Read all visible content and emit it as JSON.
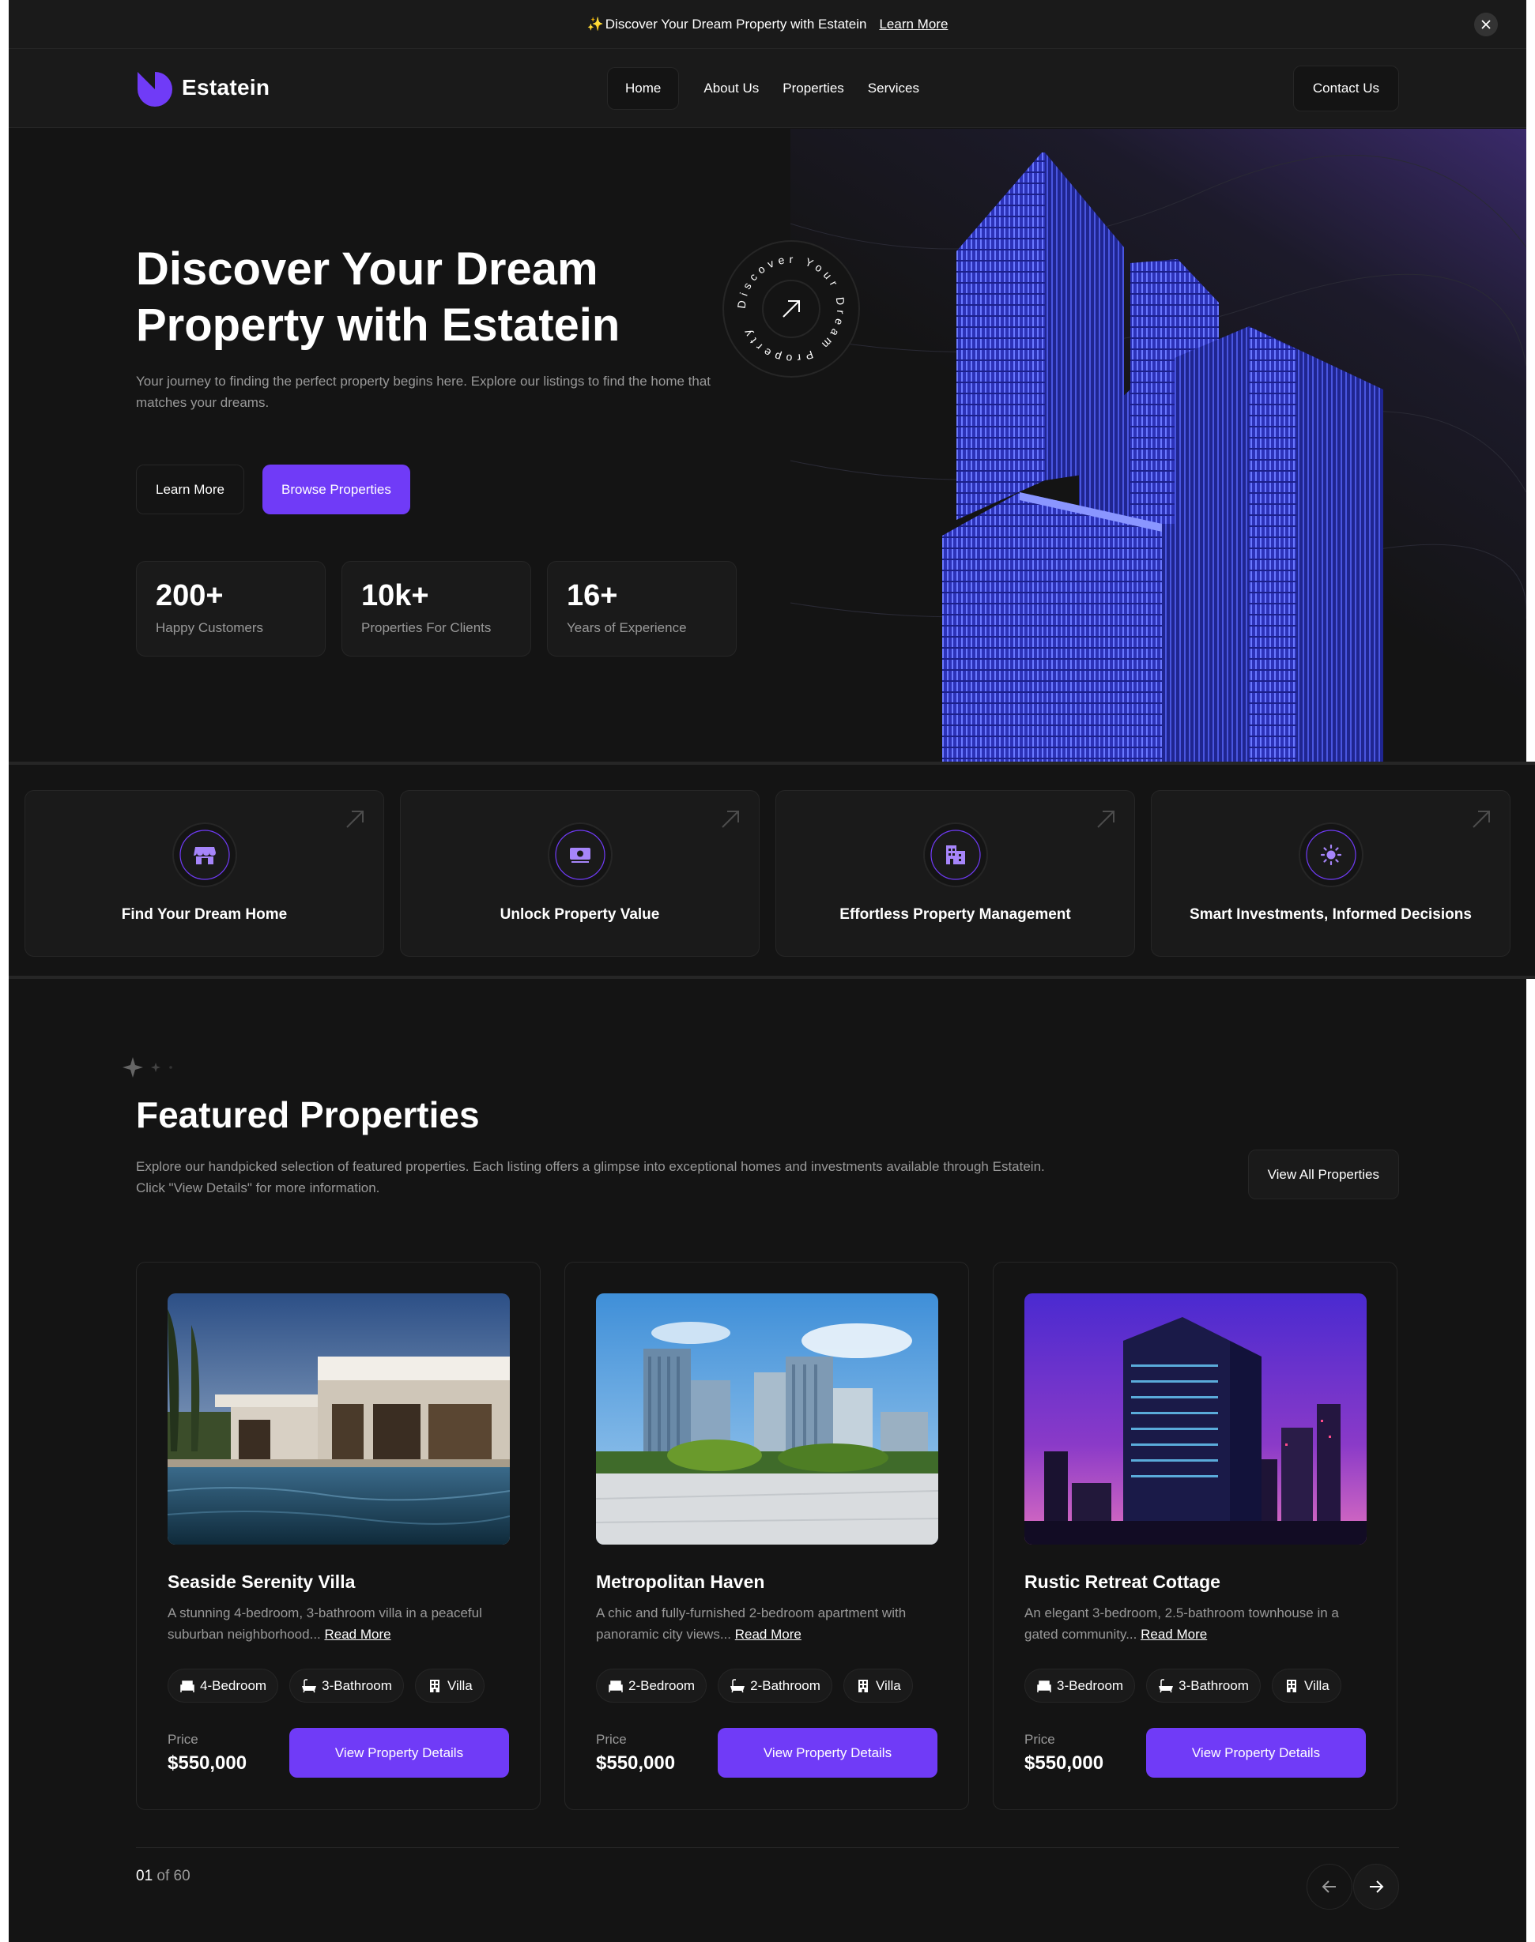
{
  "banner": {
    "text": "Discover Your Dream Property with Estatein",
    "link": "Learn More"
  },
  "nav": {
    "brand": "Estatein",
    "links": [
      "Home",
      "About Us",
      "Properties",
      "Services"
    ],
    "contact": "Contact Us"
  },
  "hero": {
    "title_line1": "Discover Your Dream",
    "title_line2": "Property with Estatein",
    "description": "Your journey to finding the perfect property begins here. Explore our listings to find the home that matches your dreams.",
    "learn_more": "Learn More",
    "browse": "Browse Properties",
    "badge_text": "Discover Your Dream Property ✨",
    "stats": [
      {
        "value": "200+",
        "label": "Happy Customers"
      },
      {
        "value": "10k+",
        "label": "Properties For Clients"
      },
      {
        "value": "16+",
        "label": "Years of Experience"
      }
    ]
  },
  "features": [
    {
      "label": "Find Your Dream Home",
      "icon": "storefront-icon"
    },
    {
      "label": "Unlock Property Value",
      "icon": "cash-icon"
    },
    {
      "label": "Effortless Property Management",
      "icon": "building-icon"
    },
    {
      "label": "Smart Investments, Informed Decisions",
      "icon": "sun-icon"
    }
  ],
  "featured": {
    "title": "Featured Properties",
    "description": "Explore our handpicked selection of featured properties. Each listing offers a glimpse into exceptional homes and investments available through Estatein. Click \"View Details\" for more information.",
    "view_all": "View All Properties",
    "cards": [
      {
        "title": "Seaside Serenity Villa",
        "desc": "A stunning 4-bedroom, 3-bathroom villa in a peaceful suburban neighborhood...",
        "read_more": "Read More",
        "tags": [
          "4-Bedroom",
          "3-Bathroom",
          "Villa"
        ],
        "price_label": "Price",
        "price": "$550,000",
        "button": "View Property Details"
      },
      {
        "title": "Metropolitan Haven",
        "desc": "A chic and fully-furnished 2-bedroom apartment with panoramic city views...",
        "read_more": "Read More",
        "tags": [
          "2-Bedroom",
          "2-Bathroom",
          "Villa"
        ],
        "price_label": "Price",
        "price": "$550,000",
        "button": "View Property Details"
      },
      {
        "title": "Rustic Retreat Cottage",
        "desc": "An elegant 3-bedroom, 2.5-bathroom townhouse in a gated community...",
        "read_more": "Read More",
        "tags": [
          "3-Bedroom",
          "3-Bathroom",
          "Villa"
        ],
        "price_label": "Price",
        "price": "$550,000",
        "button": "View Property Details"
      }
    ],
    "pager_current": "01",
    "pager_total": " of 60"
  },
  "colors": {
    "accent": "#703bf7",
    "background": "#141414",
    "surface": "#1a1a1a",
    "border": "#262626",
    "muted_text": "#999999"
  }
}
